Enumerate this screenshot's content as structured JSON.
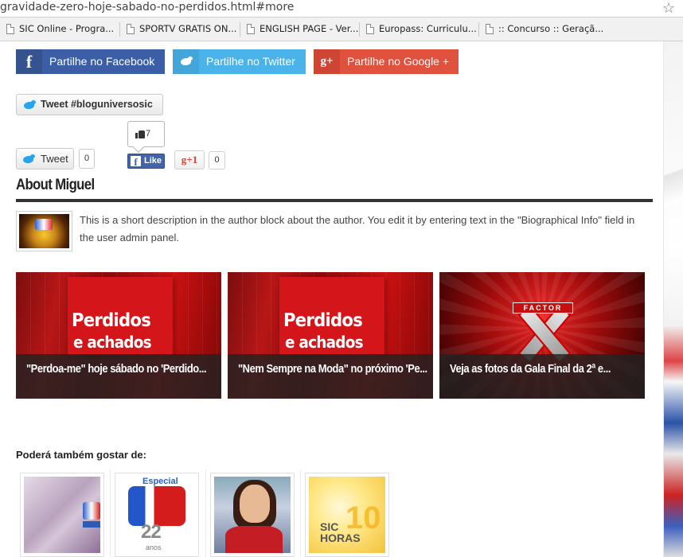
{
  "browser": {
    "url": "gravidade-zero-hoje-sabado-no-perdidos.html#more",
    "bookmarks": [
      {
        "label": "SIC Online - Progra..."
      },
      {
        "label": "SPORTV GRATIS ON..."
      },
      {
        "label": "ENGLISH PAGE - Ver..."
      },
      {
        "label": "Europass: Curriculu..."
      },
      {
        "label": ":: Concurso :: Geraçã..."
      }
    ]
  },
  "share": {
    "facebook_label": "Partilhe no Facebook",
    "twitter_label": "Partilhe no Twitter",
    "google_label": "Partilhe no Google +",
    "facebook_icon": "f",
    "google_icon": "g+"
  },
  "social": {
    "tweet_hashtag_label": "Tweet #bloguniversosic",
    "tweet_label": "Tweet",
    "tweet_count": "0",
    "like_count": "7",
    "like_label": "Like",
    "gplus_label": "g+1",
    "gplus_count": "0"
  },
  "about": {
    "title": "About Miguel",
    "description": "This is a short description in the author block about the author. You edit it by entering text in the \"Biographical Info\" field in the user admin panel."
  },
  "related": [
    {
      "image_line1": "Perdidos",
      "image_line2": "e achados",
      "caption": "\"Perdoa-me\" hoje sábado no 'Perdido..."
    },
    {
      "image_line1": "Perdidos",
      "image_line2": "e achados",
      "caption": "\"Nem Sempre na Moda\" no próximo 'Pe..."
    },
    {
      "image_label": "FACTOR",
      "caption": "Veja as fotos da Gala Final da 2ª e..."
    }
  ],
  "also_like": {
    "title": "Poderá também gostar de:",
    "thumbs": [
      {
        "text": ""
      },
      {
        "top": "Especial",
        "num": "22",
        "sub": "anos"
      },
      {
        "text": ""
      },
      {
        "line1": "SIC",
        "line2": "HORAS",
        "num": "10"
      }
    ]
  },
  "colors": {
    "facebook": "#3b5ea6",
    "twitter": "#4ab3ea",
    "google": "#e0513e"
  }
}
